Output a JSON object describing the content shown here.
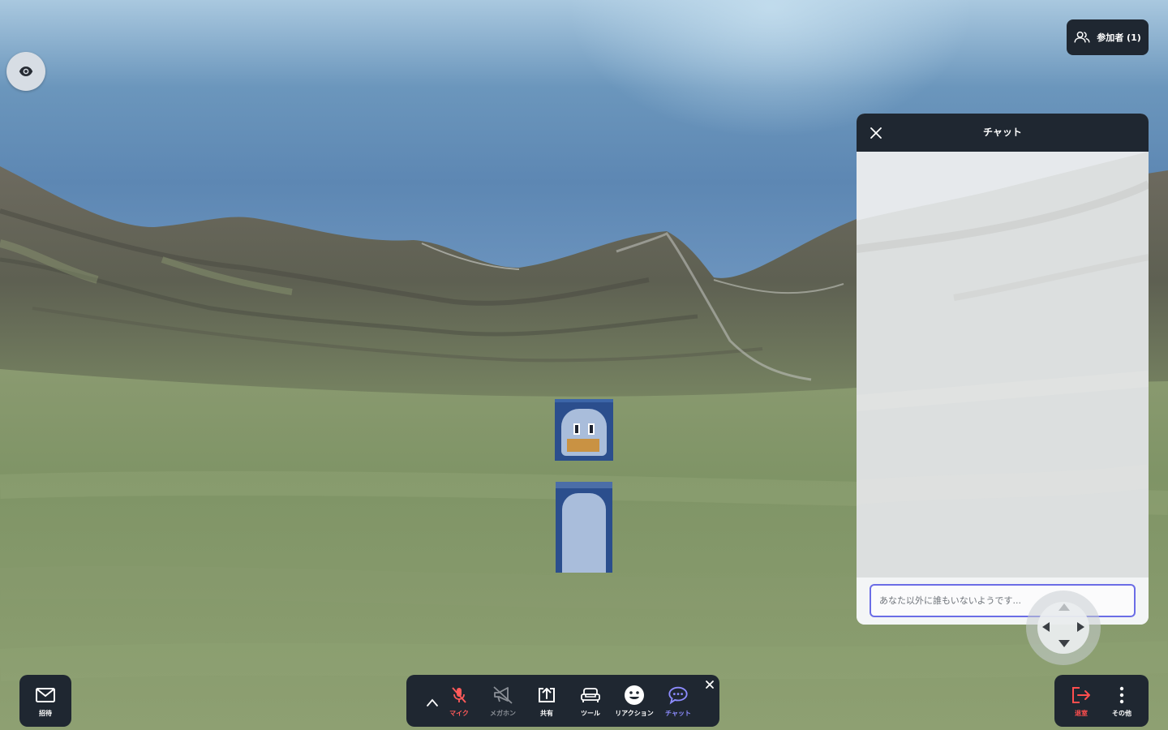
{
  "app": {
    "participants_label": "参加者 (1)"
  },
  "chat": {
    "title": "チャット",
    "input_placeholder": "あなた以外に誰もいないようです..."
  },
  "toolbar": {
    "invite_label": "招待",
    "mic_label": "マイク",
    "megaphone_label": "メガホン",
    "share_label": "共有",
    "tools_label": "ツール",
    "reaction_label": "リアクション",
    "chat_label": "チャット",
    "leave_label": "退室",
    "more_label": "その他"
  },
  "colors": {
    "bar_background": "#1f2731",
    "mic_muted": "#ff5a5a",
    "megaphone_disabled": "#8a8f96",
    "chat_active": "#8d8cff",
    "leave": "#ff4e4e",
    "input_focus": "#6b6de6"
  },
  "icons": {
    "view_toggle": "eye-icon",
    "participants": "users-icon",
    "chat_close": "close-icon",
    "invite": "mail-icon",
    "expand": "chevron-up-icon",
    "mic": "mic-off-icon",
    "megaphone": "megaphone-off-icon",
    "share": "screen-share-icon",
    "tools": "sofa-icon",
    "reaction": "smile-icon",
    "chat": "chat-bubble-icon",
    "toolbar_close": "close-icon",
    "leave": "exit-icon",
    "more": "more-vertical-icon"
  }
}
